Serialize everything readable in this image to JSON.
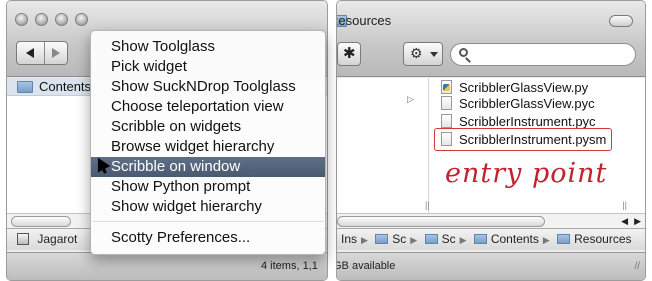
{
  "left_window": {
    "sidebar_item": "Contents",
    "bottom_item": "Jagarot",
    "status": "4 items, 1,1"
  },
  "right_window": {
    "title": "Resources",
    "files": [
      "ScribblerGlassView.py",
      "ScribblerGlassView.pyc",
      "ScribblerInstrument.pyc",
      "ScribblerInstrument.pysm"
    ],
    "annotation": "entry point",
    "path": [
      "Ins",
      "Sc",
      "Sc",
      "Contents",
      "Resources"
    ],
    "status": "GB available"
  },
  "menu": {
    "items": [
      "Show Toolglass",
      "Pick widget",
      "Show SuckNDrop Toolglass",
      "Choose teleportation view",
      "Scribble on widgets",
      "Browse widget hierarchy",
      "Scribble on window",
      "Show Python prompt",
      "Show widget hierarchy",
      "Scotty Preferences..."
    ],
    "highlighted": "Scribble on window"
  },
  "icons": [
    "close-icon",
    "minimize-icon",
    "zoom-icon",
    "back-icon",
    "forward-icon",
    "gear-icon",
    "search-icon",
    "folder-icon",
    "file-icon",
    "cursor-icon"
  ],
  "colors": {
    "menu_highlight": "#52647b",
    "annotation": "#c0232d"
  }
}
